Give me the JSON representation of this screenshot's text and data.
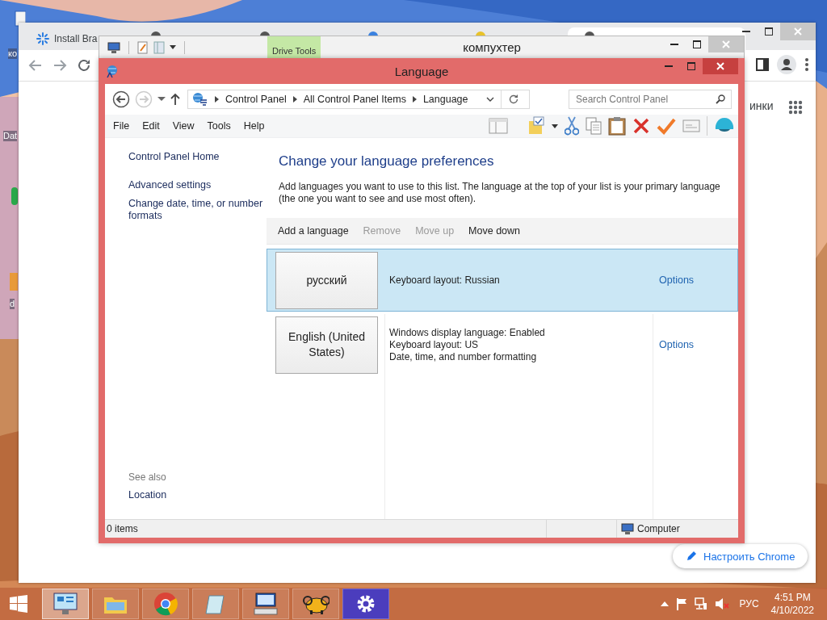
{
  "desktop_icons": [
    {
      "label": "ко"
    },
    {
      "label": "Dat"
    },
    {
      "label": "d"
    }
  ],
  "browser": {
    "tabs": [
      {
        "label": "Install Bra"
      }
    ],
    "page_text": "инки",
    "customize_button": "Настроить Chrome"
  },
  "explorer": {
    "title": "компухтер",
    "context_tab": "Drive Tools"
  },
  "language_window": {
    "title": "Language",
    "breadcrumb": [
      "Control Panel",
      "All Control Panel Items",
      "Language"
    ],
    "search": {
      "placeholder": "Search Control Panel"
    },
    "menu": [
      "File",
      "Edit",
      "View",
      "Tools",
      "Help"
    ],
    "sidebar": {
      "links": [
        "Control Panel Home",
        "Advanced settings",
        "Change date, time, or number formats"
      ],
      "see_also_heading": "See also",
      "see_also": [
        "Location"
      ]
    },
    "heading": "Change your language preferences",
    "description": "Add languages you want to use to this list. The language at the top of your list is your primary language (the one you want to see and use most often).",
    "toolbar": [
      {
        "label": "Add a language",
        "disabled": false
      },
      {
        "label": "Remove",
        "disabled": true
      },
      {
        "label": "Move up",
        "disabled": true
      },
      {
        "label": "Move down",
        "disabled": false
      }
    ],
    "languages": [
      {
        "name": "русский",
        "details": [
          "Keyboard layout: Russian"
        ],
        "options": "Options",
        "selected": true
      },
      {
        "name": "English (United States)",
        "details": [
          "Windows display language: Enabled",
          "Keyboard layout: US",
          "Date, time, and number formatting"
        ],
        "options": "Options",
        "selected": false
      }
    ],
    "status_bar": {
      "items": "0 items",
      "location": "Computer"
    }
  },
  "taskbar": {
    "language": "РУС",
    "time": "4:51 PM",
    "date": "4/10/2022"
  }
}
